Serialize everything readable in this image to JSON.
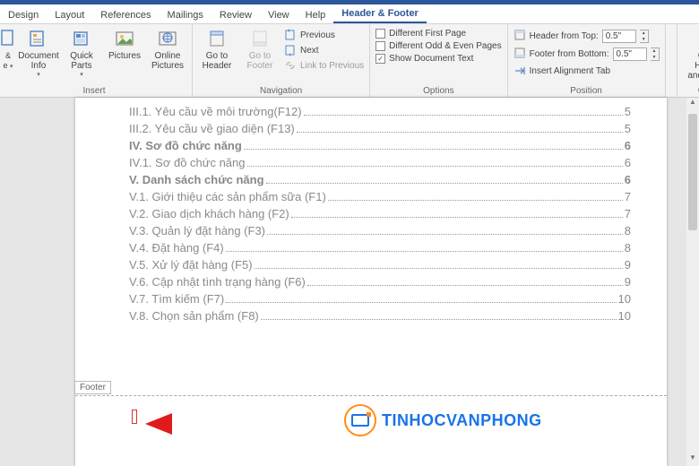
{
  "tabs": {
    "design": "Design",
    "layout": "Layout",
    "references": "References",
    "mailings": "Mailings",
    "review": "Review",
    "view": "View",
    "help": "Help",
    "headerfooter": "Header & Footer"
  },
  "ribbon": {
    "insert": {
      "label": "Insert",
      "document_info": "Document\nInfo",
      "quick_parts": "Quick\nParts",
      "pictures": "Pictures",
      "online_pictures": "Online\nPictures"
    },
    "navigation": {
      "label": "Navigation",
      "goto_header": "Go to\nHeader",
      "goto_footer": "Go to\nFooter",
      "previous": "Previous",
      "next": "Next",
      "link_previous": "Link to Previous"
    },
    "options": {
      "label": "Options",
      "diff_first": "Different First Page",
      "diff_odd_even": "Different Odd & Even Pages",
      "show_doc_text": "Show Document Text"
    },
    "position": {
      "label": "Position",
      "header_top": "Header from Top:",
      "footer_bottom": "Footer from Bottom:",
      "insert_align": "Insert Alignment Tab",
      "top_val": "0.5\"",
      "bottom_val": "0.5\""
    },
    "close": {
      "label": "Close",
      "close_hf": "Close Header\nand Footer"
    }
  },
  "toc": [
    {
      "title": "III.1. Yêu cầu về môi trường(F12)",
      "page": "5",
      "bold": false
    },
    {
      "title": "III.2. Yêu cầu về giao diện (F13)",
      "page": "5",
      "bold": false
    },
    {
      "title": "IV. Sơ đồ chức năng",
      "page": "6",
      "bold": true
    },
    {
      "title": "IV.1. Sơ đồ chức năng",
      "page": "6",
      "bold": false
    },
    {
      "title": "V. Danh sách chức năng",
      "page": "6",
      "bold": true
    },
    {
      "title": "V.1. Giới thiệu các sản phẩm sữa (F1)",
      "page": "7",
      "bold": false
    },
    {
      "title": "V.2. Giao dịch khách hàng (F2)",
      "page": "7",
      "bold": false
    },
    {
      "title": "V.3. Quản lý đặt hàng (F3)",
      "page": "8",
      "bold": false
    },
    {
      "title": "V.4. Đặt hàng (F4)",
      "page": "8",
      "bold": false
    },
    {
      "title": "V.5. Xử lý đặt hàng (F5)",
      "page": "9",
      "bold": false
    },
    {
      "title": "V.6. Cập nhật tình trạng hàng (F6)",
      "page": "9",
      "bold": false
    },
    {
      "title": "V.7. Tìm kiếm (F7)",
      "page": "10",
      "bold": false
    },
    {
      "title": "V.8. Chọn sản phẩm (F8)",
      "page": "10",
      "bold": false
    }
  ],
  "footer_tag": "Footer",
  "watermark": "TINHOCVANPHONG"
}
